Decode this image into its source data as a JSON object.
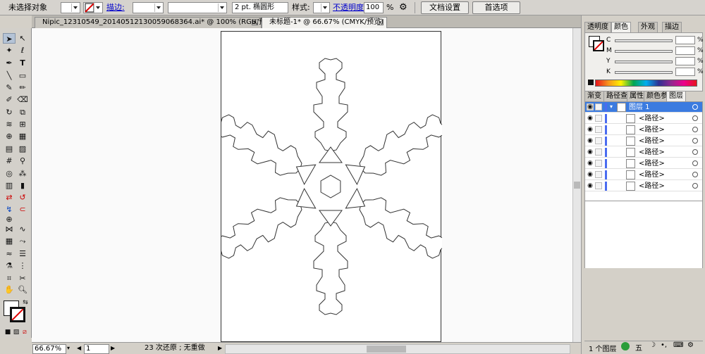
{
  "control_bar": {
    "selection_status": "未选择对象",
    "stroke_label": "描边:",
    "stroke_profile": "2 pt. 椭圆形",
    "style_label": "样式:",
    "opacity_label": "不透明度:",
    "opacity_value": "100",
    "opacity_unit": "%",
    "doc_settings_button": "文档设置",
    "preferences_button": "首选项"
  },
  "document_tabs": [
    {
      "label": "Nipic_12310549_20140512130059068364.ai* @ 100% (RGB/预览)",
      "active": false
    },
    {
      "label": "未标题-1* @ 66.67% (CMYK/预览)",
      "active": true
    }
  ],
  "color_panel": {
    "tabs": [
      "透明度",
      "颜色",
      "外观",
      "描边"
    ],
    "active_tab": "颜色",
    "channels": [
      {
        "label": "C",
        "value": "",
        "unit": "%"
      },
      {
        "label": "M",
        "value": "",
        "unit": "%"
      },
      {
        "label": "Y",
        "value": "",
        "unit": "%"
      },
      {
        "label": "K",
        "value": "",
        "unit": "%"
      }
    ]
  },
  "layers_panel": {
    "tabs": [
      "渐变",
      "路径查",
      "属性",
      "颜色参",
      "图层"
    ],
    "active_tab": "图层",
    "layer_name": "图层 1",
    "items": [
      "<路径>",
      "<路径>",
      "<路径>",
      "<路径>",
      "<路径>",
      "<路径>",
      "<路径>"
    ],
    "footer": "1 个图层"
  },
  "status_bar": {
    "zoom": "66.67%",
    "artboard": "1",
    "undo_text": "23 次还原 ; 无重做"
  },
  "colors": {
    "selected_layer": "#3b7be0",
    "layer_color_bar": "#4a6cf0",
    "link": "#0000cc"
  }
}
